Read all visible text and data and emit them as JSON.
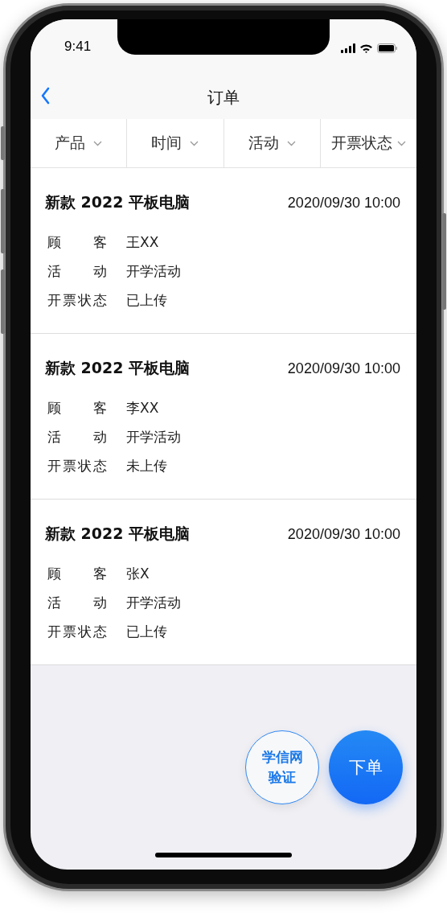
{
  "status_bar": {
    "time": "9:41"
  },
  "nav": {
    "title": "订单"
  },
  "filters": [
    {
      "label": "产品"
    },
    {
      "label": "时间"
    },
    {
      "label": "活动"
    },
    {
      "label": "开票状态"
    }
  ],
  "orders": [
    {
      "product": "新款 2022 平板电脑",
      "time": "2020/09/30 10:00",
      "fields": [
        {
          "label": "顾客",
          "value": "王XX"
        },
        {
          "label": "活动",
          "value": "开学活动"
        },
        {
          "label": "开票状态",
          "value": "已上传"
        }
      ]
    },
    {
      "product": "新款 2022 平板电脑",
      "time": "2020/09/30 10:00",
      "fields": [
        {
          "label": "顾客",
          "value": "李XX"
        },
        {
          "label": "活动",
          "value": "开学活动"
        },
        {
          "label": "开票状态",
          "value": "未上传"
        }
      ]
    },
    {
      "product": "新款 2022 平板电脑",
      "time": "2020/09/30 10:00",
      "fields": [
        {
          "label": "顾客",
          "value": "张X"
        },
        {
          "label": "活动",
          "value": "开学活动"
        },
        {
          "label": "开票状态",
          "value": "已上传"
        }
      ]
    }
  ],
  "actions": [
    {
      "kind": "outline",
      "label": "学信网验证"
    },
    {
      "kind": "filled",
      "label": "下单"
    }
  ]
}
